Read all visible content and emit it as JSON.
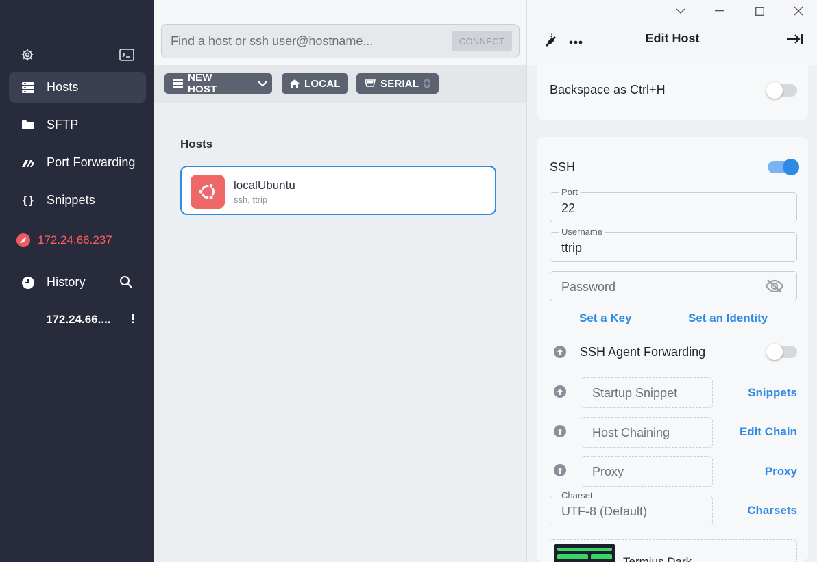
{
  "sidebar": {
    "settings_icon": "gear-icon",
    "terminal_icon": "terminal-icon",
    "nav": [
      {
        "label": "Hosts",
        "icon": "hosts-icon"
      },
      {
        "label": "SFTP",
        "icon": "folder-icon"
      },
      {
        "label": "Port Forwarding",
        "icon": "forward-icon"
      },
      {
        "label": "Snippets",
        "icon": "braces-icon"
      }
    ],
    "active_connection": "172.24.66.237",
    "history_label": "History",
    "history_items": [
      {
        "label": "172.24.66....",
        "status": "!"
      }
    ]
  },
  "search": {
    "placeholder": "Find a host or ssh user@hostname...",
    "connect_label": "CONNECT"
  },
  "toolbar": {
    "new_host": "NEW HOST",
    "local": "LOCAL",
    "serial": "SERIAL"
  },
  "hosts": {
    "title": "Hosts",
    "items": [
      {
        "name": "localUbuntu",
        "subtitle": "ssh, ttrip",
        "icon": "ubuntu-icon"
      }
    ]
  },
  "edit_host": {
    "title": "Edit Host",
    "backspace_label": "Backspace as Ctrl+H",
    "backspace_on": false,
    "ssh_label": "SSH",
    "ssh_on": true,
    "port_label": "Port",
    "port_value": "22",
    "username_label": "Username",
    "username_value": "ttrip",
    "password_placeholder": "Password",
    "set_key": "Set a Key",
    "set_identity": "Set an Identity",
    "agent_forwarding_label": "SSH Agent Forwarding",
    "agent_forwarding_on": false,
    "startup_snippet_placeholder": "Startup Snippet",
    "snippets_link": "Snippets",
    "host_chaining_placeholder": "Host Chaining",
    "edit_chain_link": "Edit Chain",
    "proxy_placeholder": "Proxy",
    "proxy_link": "Proxy",
    "charset_label": "Charset",
    "charset_value": "UTF-8 (Default)",
    "charsets_link": "Charsets",
    "theme_name": "Termius Dark"
  },
  "colors": {
    "sidebar_bg": "#272b3b",
    "accent": "#2f8ae6",
    "danger": "#ff5c64",
    "ubuntu": "#f06767"
  }
}
